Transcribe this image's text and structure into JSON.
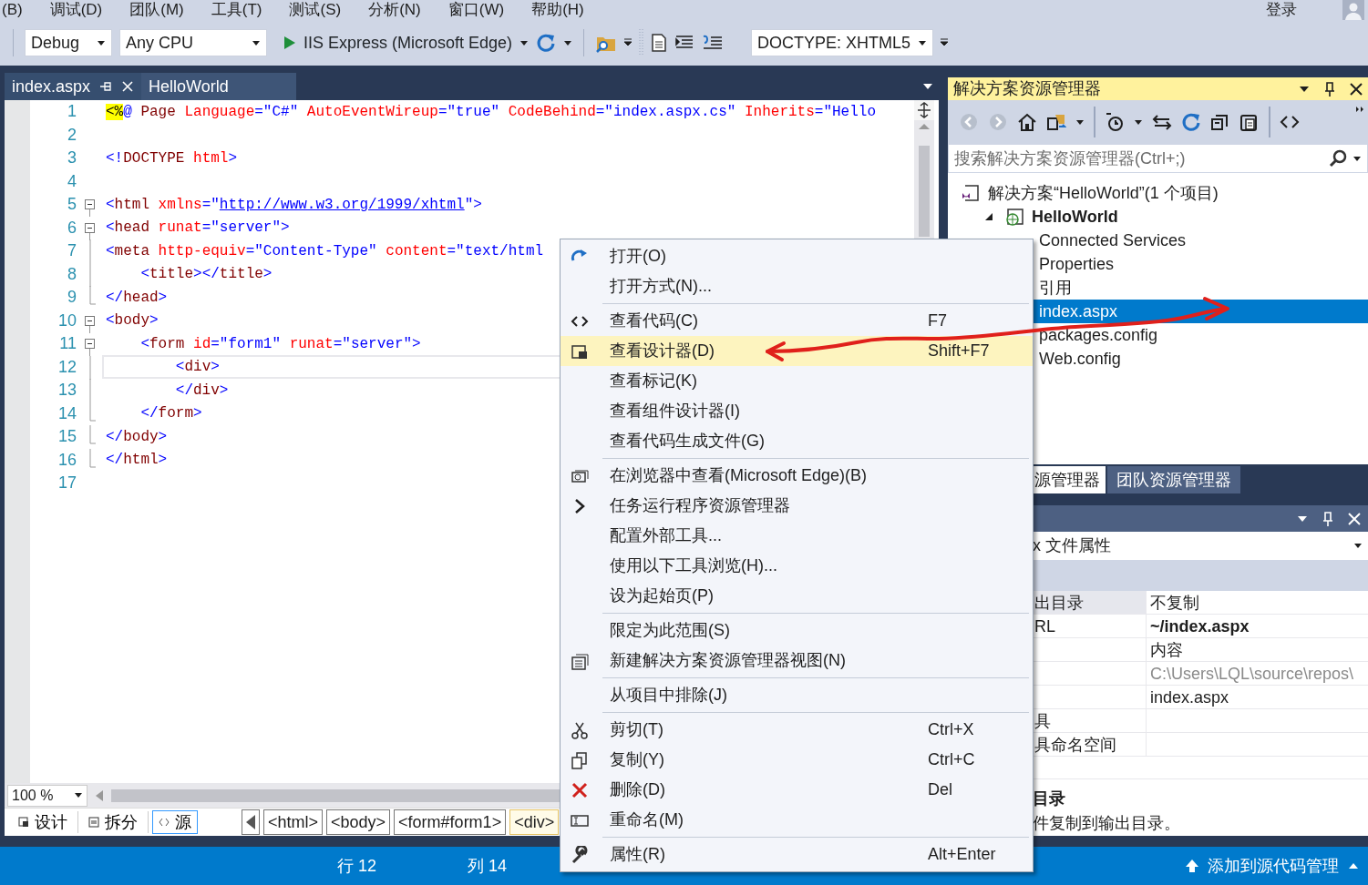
{
  "menu_bar": {
    "items": [
      "(B)",
      "调试(D)",
      "团队(M)",
      "工具(T)",
      "测试(S)",
      "分析(N)",
      "窗口(W)",
      "帮助(H)"
    ],
    "sign_in": "登录"
  },
  "toolbar": {
    "configuration": "Debug",
    "platform": "Any CPU",
    "run_target": "IIS Express (Microsoft Edge)",
    "doctype": "DOCTYPE: XHTML5"
  },
  "document_tabs": [
    {
      "label": "index.aspx",
      "selected": true
    },
    {
      "label": "HelloWorld",
      "selected": false
    }
  ],
  "editor": {
    "lines": [
      {
        "number": "1",
        "current": false,
        "kind": "plain",
        "tokens": [
          {
            "kind": "hl",
            "t": "<%"
          },
          {
            "kind": "delim",
            "t": "@"
          },
          {
            "kind": "el",
            "t": " Page"
          },
          {
            "kind": "attr",
            "t": " Language"
          },
          {
            "kind": "delim",
            "t": "=\""
          },
          {
            "kind": "val",
            "t": "C#"
          },
          {
            "kind": "delim",
            "t": "\""
          },
          {
            "kind": "attr",
            "t": " AutoEventWireup"
          },
          {
            "kind": "delim",
            "t": "=\""
          },
          {
            "kind": "val",
            "t": "true"
          },
          {
            "kind": "delim",
            "t": "\""
          },
          {
            "kind": "attr",
            "t": " CodeBehind"
          },
          {
            "kind": "delim",
            "t": "=\""
          },
          {
            "kind": "val",
            "t": "index.aspx.cs"
          },
          {
            "kind": "delim",
            "t": "\""
          },
          {
            "kind": "attr",
            "t": " Inherits"
          },
          {
            "kind": "delim",
            "t": "=\""
          },
          {
            "kind": "val",
            "t": "Hello"
          }
        ]
      },
      {
        "number": "2",
        "current": false,
        "kind": "plain"
      },
      {
        "number": "3",
        "current": false,
        "kind": "plain",
        "tokens": [
          {
            "kind": "delim",
            "t": "<!"
          },
          {
            "kind": "el",
            "t": "DOCTYPE"
          },
          {
            "kind": "attr",
            "t": " html"
          },
          {
            "kind": "delim",
            "t": ">"
          }
        ]
      },
      {
        "number": "4",
        "current": false,
        "kind": "plain"
      },
      {
        "number": "5",
        "current": false,
        "kind": "open",
        "tokens": [
          {
            "kind": "delim",
            "t": "<"
          },
          {
            "kind": "el",
            "t": "html"
          },
          {
            "kind": "attr",
            "t": " xmlns"
          },
          {
            "kind": "delim",
            "t": "=\""
          },
          {
            "kind": "link",
            "t": "http://www.w3.org/1999/xhtml"
          },
          {
            "kind": "delim",
            "t": "\">"
          }
        ]
      },
      {
        "number": "6",
        "current": false,
        "kind": "open",
        "tokens": [
          {
            "kind": "delim",
            "t": "<"
          },
          {
            "kind": "el",
            "t": "head"
          },
          {
            "kind": "attr",
            "t": " runat"
          },
          {
            "kind": "delim",
            "t": "=\""
          },
          {
            "kind": "val",
            "t": "server"
          },
          {
            "kind": "delim",
            "t": "\">"
          }
        ]
      },
      {
        "number": "7",
        "current": false,
        "kind": "line",
        "tokens": [
          {
            "kind": "delim",
            "t": "<"
          },
          {
            "kind": "el",
            "t": "meta"
          },
          {
            "kind": "attr",
            "t": " http-equiv"
          },
          {
            "kind": "delim",
            "t": "=\""
          },
          {
            "kind": "val",
            "t": "Content-Type"
          },
          {
            "kind": "delim",
            "t": "\""
          },
          {
            "kind": "attr",
            "t": " content"
          },
          {
            "kind": "delim",
            "t": "=\""
          },
          {
            "kind": "val",
            "t": "text/html"
          }
        ]
      },
      {
        "number": "8",
        "current": false,
        "kind": "line",
        "tokens": [
          {
            "kind": "delim",
            "t": "    <"
          },
          {
            "kind": "el",
            "t": "title"
          },
          {
            "kind": "delim",
            "t": "></"
          },
          {
            "kind": "el",
            "t": "title"
          },
          {
            "kind": "delim",
            "t": ">"
          }
        ]
      },
      {
        "number": "9",
        "current": false,
        "kind": "end",
        "tokens": [
          {
            "kind": "delim",
            "t": "</"
          },
          {
            "kind": "el",
            "t": "head"
          },
          {
            "kind": "delim",
            "t": ">"
          }
        ]
      },
      {
        "number": "10",
        "current": false,
        "kind": "open",
        "tokens": [
          {
            "kind": "delim",
            "t": "<"
          },
          {
            "kind": "el",
            "t": "body"
          },
          {
            "kind": "delim",
            "t": ">"
          }
        ]
      },
      {
        "number": "11",
        "current": false,
        "kind": "open",
        "tokens": [
          {
            "kind": "delim",
            "t": "    <"
          },
          {
            "kind": "el",
            "t": "form"
          },
          {
            "kind": "attr",
            "t": " id"
          },
          {
            "kind": "delim",
            "t": "=\""
          },
          {
            "kind": "val",
            "t": "form1"
          },
          {
            "kind": "delim",
            "t": "\""
          },
          {
            "kind": "attr",
            "t": " runat"
          },
          {
            "kind": "delim",
            "t": "=\""
          },
          {
            "kind": "val",
            "t": "server"
          },
          {
            "kind": "delim",
            "t": "\">"
          }
        ]
      },
      {
        "number": "12",
        "current": true,
        "kind": "line",
        "tokens": [
          {
            "kind": "delim",
            "t": "        <"
          },
          {
            "kind": "el",
            "t": "div"
          },
          {
            "kind": "delim",
            "t": ">"
          }
        ]
      },
      {
        "number": "13",
        "current": false,
        "kind": "line",
        "tokens": [
          {
            "kind": "delim",
            "t": "        </"
          },
          {
            "kind": "el",
            "t": "div"
          },
          {
            "kind": "delim",
            "t": ">"
          }
        ]
      },
      {
        "number": "14",
        "current": false,
        "kind": "end",
        "tokens": [
          {
            "kind": "delim",
            "t": "    </"
          },
          {
            "kind": "el",
            "t": "form"
          },
          {
            "kind": "delim",
            "t": ">"
          }
        ]
      },
      {
        "number": "15",
        "current": false,
        "kind": "end",
        "tokens": [
          {
            "kind": "delim",
            "t": "</"
          },
          {
            "kind": "el",
            "t": "body"
          },
          {
            "kind": "delim",
            "t": ">"
          }
        ]
      },
      {
        "number": "16",
        "current": false,
        "kind": "end",
        "tokens": [
          {
            "kind": "delim",
            "t": "</"
          },
          {
            "kind": "el",
            "t": "html"
          },
          {
            "kind": "delim",
            "t": ">"
          }
        ]
      },
      {
        "number": "17",
        "current": false,
        "kind": "plain"
      }
    ]
  },
  "editor_footer": {
    "zoom": "100 %",
    "views": [
      {
        "label": "设计",
        "selected": false
      },
      {
        "label": "拆分",
        "selected": false
      },
      {
        "label": "源",
        "selected": true
      }
    ],
    "breadcrumbs": [
      {
        "label": "<html>",
        "selected": false
      },
      {
        "label": "<body>",
        "selected": false
      },
      {
        "label": "<form#form1>",
        "selected": false
      },
      {
        "label": "<div>",
        "selected": true
      }
    ]
  },
  "solution_explorer": {
    "title": "解决方案资源管理器",
    "search": {
      "placeholder": "搜索解决方案资源管理器(Ctrl+;)"
    },
    "tree": [
      {
        "label": "解决方案“HelloWorld”(1 个项目)",
        "kind": "solution",
        "selected": false,
        "children": [
          {
            "label": "HelloWorld",
            "kind": "project",
            "expanded": true,
            "selected": false,
            "children": [
              {
                "label": "Connected Services",
                "selected": false
              },
              {
                "label": "Properties",
                "selected": false
              },
              {
                "label": "引用",
                "selected": false
              },
              {
                "label": "index.aspx",
                "selected": true
              },
              {
                "label": "packages.config",
                "selected": false
              },
              {
                "label": "Web.config",
                "selected": false
              }
            ]
          }
        ]
      }
    ]
  },
  "panel_tabs": [
    {
      "label": "源管理器",
      "selected": true
    },
    {
      "label": "团队资源管理器",
      "selected": false
    }
  ],
  "properties": {
    "object": "x 文件属性",
    "rows": [
      {
        "name": "出目录",
        "value": "不复制",
        "selected": true,
        "bold": false,
        "readonly": false
      },
      {
        "name": "RL",
        "value": "~/index.aspx",
        "selected": false,
        "bold": true,
        "readonly": false
      },
      {
        "value": "内容",
        "selected": false,
        "bold": false,
        "readonly": false
      },
      {
        "value": "C:\\Users\\LQL\\source\\repos\\",
        "selected": false,
        "bold": false,
        "readonly": true
      },
      {
        "value": "index.aspx",
        "selected": false,
        "bold": false,
        "readonly": false
      },
      {
        "name": "具",
        "selected": false
      },
      {
        "name": "具命名空间",
        "selected": false
      }
    ],
    "description": {
      "title": "目录",
      "text": "件复制到输出目录。"
    }
  },
  "context_menu": {
    "items": [
      {
        "kind": "command",
        "label": "打开(O)",
        "selected": false
      },
      {
        "kind": "command",
        "label": "打开方式(N)...",
        "selected": false
      },
      {
        "kind": "separator"
      },
      {
        "kind": "command",
        "label": "查看代码(C)",
        "shortcut": "F7",
        "selected": false
      },
      {
        "kind": "command",
        "label": "查看设计器(D)",
        "shortcut": "Shift+F7",
        "selected": true
      },
      {
        "kind": "command",
        "label": "查看标记(K)",
        "selected": false
      },
      {
        "kind": "command",
        "label": "查看组件设计器(I)",
        "selected": false
      },
      {
        "kind": "command",
        "label": "查看代码生成文件(G)",
        "selected": false
      },
      {
        "kind": "separator"
      },
      {
        "kind": "command",
        "label": "在浏览器中查看(Microsoft Edge)(B)",
        "selected": false
      },
      {
        "kind": "command",
        "label": "任务运行程序资源管理器",
        "selected": false
      },
      {
        "kind": "command",
        "label": "配置外部工具...",
        "selected": false
      },
      {
        "kind": "command",
        "label": "使用以下工具浏览(H)...",
        "selected": false
      },
      {
        "kind": "command",
        "label": "设为起始页(P)",
        "selected": false
      },
      {
        "kind": "separator"
      },
      {
        "kind": "command",
        "label": "限定为此范围(S)",
        "selected": false
      },
      {
        "kind": "command",
        "label": "新建解决方案资源管理器视图(N)",
        "selected": false
      },
      {
        "kind": "separator"
      },
      {
        "kind": "command",
        "label": "从项目中排除(J)",
        "selected": false
      },
      {
        "kind": "separator"
      },
      {
        "kind": "command",
        "label": "剪切(T)",
        "shortcut": "Ctrl+X",
        "selected": false
      },
      {
        "kind": "command",
        "label": "复制(Y)",
        "shortcut": "Ctrl+C",
        "selected": false
      },
      {
        "kind": "command",
        "label": "删除(D)",
        "shortcut": "Del",
        "selected": false
      },
      {
        "kind": "command",
        "label": "重命名(M)",
        "selected": false
      },
      {
        "kind": "separator"
      },
      {
        "kind": "command",
        "label": "属性(R)",
        "shortcut": "Alt+Enter",
        "selected": false
      }
    ]
  },
  "status_bar": {
    "line": "行 12",
    "column": "列 14",
    "source_control": "添加到源代码管理"
  }
}
